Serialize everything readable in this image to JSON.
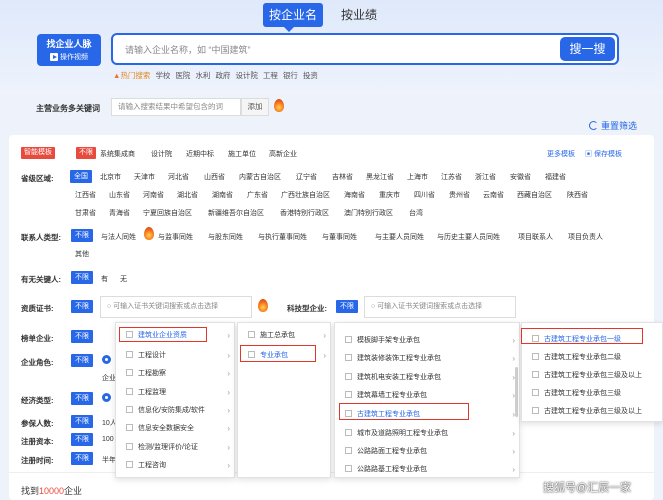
{
  "tabs": [
    {
      "label": "按企业名"
    },
    {
      "label": "按业绩"
    }
  ],
  "promo": {
    "title": "找企业人脉",
    "video": "操作视频"
  },
  "search": {
    "placeholder": "请输入企业名称，如 “中国建筑”",
    "button": "搜一搜"
  },
  "hot": {
    "label": "热门搜索",
    "items": [
      "学校",
      "医院",
      "水利",
      "政府",
      "设计院",
      "工程",
      "银行",
      "投资"
    ]
  },
  "keyword": {
    "label": "主营业务多关键词",
    "placeholder": "请输入搜索结果中希望包含的词",
    "add": "添加"
  },
  "reset": "重置筛选",
  "smart": {
    "label": "智能模板",
    "unlimited": "不限",
    "items": [
      "系统集成商",
      "设计院",
      "近期中标",
      "施工单位",
      "高新企业"
    ],
    "more": "更多模板",
    "save": "保存模板"
  },
  "region": {
    "label": "省级区域:",
    "all": "全国",
    "row1": [
      "北京市",
      "天津市",
      "河北省",
      "山西省",
      "内蒙古自治区",
      "辽宁省",
      "吉林省",
      "黑龙江省",
      "上海市",
      "江苏省",
      "浙江省",
      "安徽省",
      "福建省"
    ],
    "row2": [
      "江西省",
      "山东省",
      "河南省",
      "湖北省",
      "湖南省",
      "广东省",
      "广西壮族自治区",
      "海南省",
      "重庆市",
      "四川省",
      "贵州省",
      "云南省",
      "西藏自治区",
      "陕西省"
    ],
    "row3": [
      "甘肃省",
      "青海省",
      "宁夏回族自治区",
      "新疆维吾尔自治区",
      "香港特别行政区",
      "澳门特别行政区",
      "台湾"
    ]
  },
  "contact": {
    "label": "联系人类型:",
    "unlimited": "不限",
    "items": [
      "与法人同姓",
      "与监事同姓",
      "与股东同姓",
      "与执行董事同姓",
      "与董事同姓",
      "与主要人员同姓",
      "与历史主要人员同姓",
      "项目联系人",
      "项目负责人"
    ],
    "other": "其他"
  },
  "contactable": {
    "label": "有无关键人:",
    "unlimited": "不限",
    "yes": "有",
    "no": "无"
  },
  "cert": {
    "label": "资质证书:",
    "unlimited": "不限",
    "placeholder": "可输入证书关键词搜索或点击选择"
  },
  "tech": {
    "label": "科技型企业:",
    "unlimited": "不限",
    "placeholder": "可输入证书关键词搜索或点击选择"
  },
  "lower_rows": [
    {
      "label": "榜单企业:",
      "unlimited": "不限"
    },
    {
      "label": "企业角色:",
      "unlimited": "不限"
    },
    {
      "label": "经济类型:",
      "unlimited": "不限"
    },
    {
      "label": "参保人数:",
      "unlimited": "不限"
    },
    {
      "label": "注册资本:",
      "unlimited": "不限"
    },
    {
      "label": "注册时间:",
      "unlimited": "不限"
    }
  ],
  "partial_texts": [
    "企业",
    "10人",
    "100",
    "半年"
  ],
  "menu1": [
    "建筑业企业资质",
    "工程设计",
    "工程勘察",
    "工程监理",
    "信息化/安防集成/软件",
    "信息安全数据安全",
    "检测/监理评价/论证",
    "工程咨询"
  ],
  "menu2": [
    "施工总承包",
    "专业承包"
  ],
  "menu3": [
    "模板脚手架专业承包",
    "建筑装修装饰工程专业承包",
    "建筑机电安装工程专业承包",
    "建筑幕墙工程专业承包",
    "古建筑工程专业承包",
    "城市及道路照明工程专业承包",
    "公路路面工程专业承包",
    "公路路基工程专业承包"
  ],
  "menu4": [
    "古建筑工程专业承包一级",
    "古建筑工程专业承包二级",
    "古建筑工程专业承包三级及以上",
    "古建筑工程专业承包三级",
    "古建筑工程专业承包三级及以上"
  ],
  "found": {
    "prefix": "找到",
    "count": "10000",
    "suffix": "企业"
  },
  "watermark": "搜狐号@汇辰一家",
  "colors": {
    "accent": "#2767e8",
    "danger": "#e84a3d"
  }
}
